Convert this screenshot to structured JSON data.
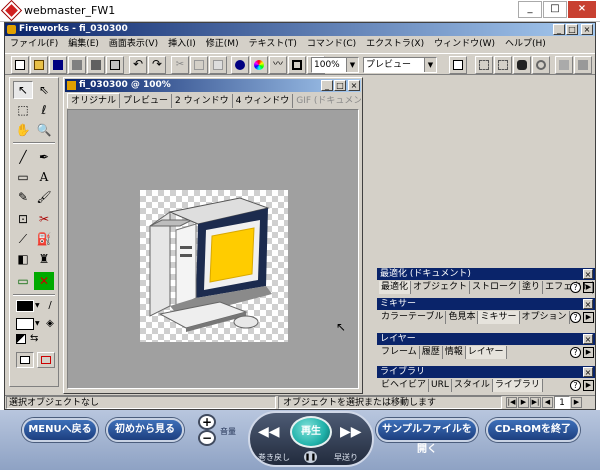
{
  "outer_window": {
    "title": "webmaster_FW1"
  },
  "app_window": {
    "title": "Fireworks - fi_030300"
  },
  "menu": [
    "ファイル(F)",
    "編集(E)",
    "画面表示(V)",
    "挿入(I)",
    "修正(M)",
    "テキスト(T)",
    "コマンド(C)",
    "エクストラ(X)",
    "ウィンドウ(W)",
    "ヘルプ(H)"
  ],
  "toolbar": {
    "zoom_value": "100%",
    "preview_value": "プレビュー"
  },
  "document": {
    "title": "fi_030300 @ 100%",
    "tabs": [
      "オリジナル",
      "プレビュー",
      "2 ウィンドウ",
      "4 ウィンドウ",
      "GIF (ドキュメント プレー"
    ]
  },
  "panels": [
    {
      "title": "最適化 (ドキュメント)",
      "tabs": [
        "最適化",
        "オブジェクト",
        "ストローク",
        "塗り",
        "エフェクト"
      ]
    },
    {
      "title": "ミキサー",
      "tabs": [
        "カラーテーブル",
        "色見本",
        "ミキサー",
        "オプション"
      ]
    },
    {
      "title": "レイヤー",
      "tabs": [
        "フレーム",
        "履歴",
        "情報",
        "レイヤー"
      ]
    },
    {
      "title": "ライブラリ",
      "tabs": [
        "ビヘイビア",
        "URL",
        "スタイル",
        "ライブラリ"
      ]
    }
  ],
  "status": {
    "left": "選択オブジェクトなし",
    "center": "オブジェクトを選択または移動します",
    "frame": "1"
  },
  "player": {
    "menu_back": "MENUへ戻る",
    "from_start": "初めから見る",
    "volume": "音量",
    "play": "再生",
    "rewind": "巻き戻し",
    "fast_forward": "早送り",
    "open_sample": "サンプルファイルを開く",
    "end_cdrom": "CD-ROMを終了"
  },
  "colors": {
    "title_active": "#0a246a",
    "title_gradient_end": "#a6caf0",
    "chrome": "#d4d0c8",
    "player_blue": "#1d3f80",
    "play_teal": "#20b2aa",
    "screen_yellow": "#ffcc00"
  }
}
